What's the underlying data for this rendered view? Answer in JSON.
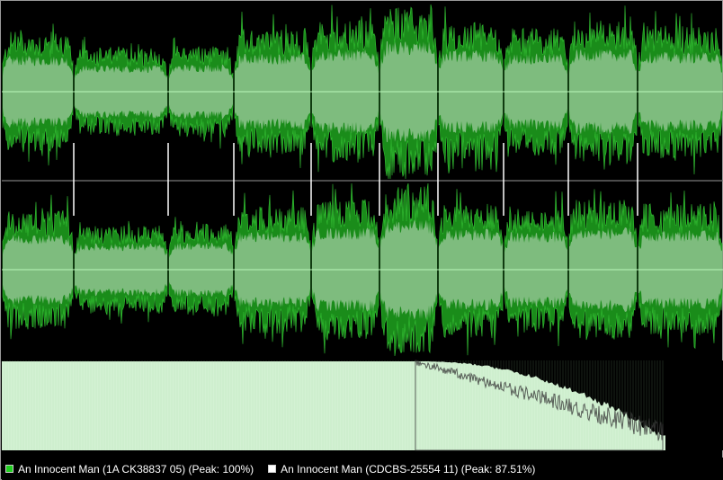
{
  "window": {
    "legend": [
      {
        "label": "An Innocent Man (1A CK38837 05) (Peak: 100%)",
        "color": "#1fcf1f",
        "icon": "green-square-icon"
      },
      {
        "label": "An Innocent Man (CDCBS-25554 11) (Peak: 87.51%)",
        "color": "#ffffff",
        "icon": "white-square-icon"
      }
    ]
  },
  "colors": {
    "background": "#000000",
    "peak": "#1a8c1a",
    "peak_bright": "#35c235",
    "rms": "#84bf84",
    "center_line": "#b9f7b9",
    "channel_divider": "#7a7a7a",
    "spectrum_fill": "#d3f1d3",
    "spectrum_other": "#bdbdbd",
    "marker": "#ffffff"
  },
  "tracks": {
    "count": 10,
    "overlay_peak_fraction": 0.8751
  }
}
